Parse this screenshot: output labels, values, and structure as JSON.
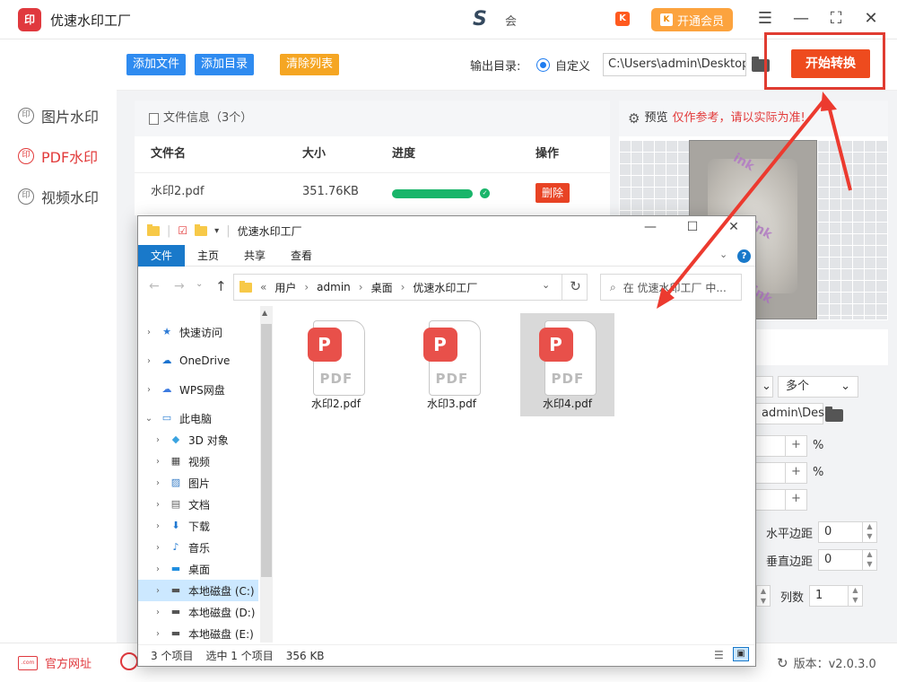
{
  "app": {
    "title": "优速水印工厂",
    "logo_text": "印",
    "username": "会"
  },
  "header": {
    "vip_label": "开通会员",
    "vip_icon_text": "K",
    "accent": "#ee4b1e"
  },
  "sidebar": {
    "items": [
      {
        "label": "图片水印",
        "icon": "印",
        "active": false
      },
      {
        "label": "PDF水印",
        "icon": "印",
        "active": true
      },
      {
        "label": "视频水印",
        "icon": "印",
        "active": false
      }
    ]
  },
  "toolbar": {
    "add_file": "添加文件",
    "add_dir": "添加目录",
    "clear_list": "清除列表",
    "output_label": "输出目录:",
    "custom_label": "自定义",
    "output_path": "C:\\Users\\admin\\Desktop",
    "start": "开始转换"
  },
  "filelist": {
    "header": "文件信息（3个）",
    "columns": [
      "文件名",
      "大小",
      "进度",
      "操作"
    ],
    "rows": [
      {
        "name": "水印2.pdf",
        "size": "351.76KB",
        "progress": 1.0,
        "action": "删除"
      }
    ]
  },
  "preview": {
    "label": "预览",
    "note": "仅作参考，请以实际为准!",
    "watermark": "ink"
  },
  "settings": {
    "select_value": "多个",
    "path_fragment": "admin\\Des",
    "pct1": "%",
    "pct2": "%",
    "h_margin_label": "水平边距",
    "h_margin_value": "0",
    "v_margin_label": "垂直边距",
    "v_margin_value": "0",
    "cols_label": "列数",
    "cols_value": "1"
  },
  "footer": {
    "website": "官方网址",
    "version": "版本：v2.0.3.0",
    "com_icon": ".com"
  },
  "explorer": {
    "title": "优速水印工厂",
    "ribbon_tabs": [
      "文件",
      "主页",
      "共享",
      "查看"
    ],
    "breadcrumb": [
      "用户",
      "admin",
      "桌面",
      "优速水印工厂"
    ],
    "search_placeholder": "在 优速水印工厂 中...",
    "nav": [
      {
        "label": "快速访问",
        "icon": "★",
        "color": "#2e7bd6"
      },
      {
        "label": "OneDrive",
        "icon": "☁",
        "color": "#1a73d0"
      },
      {
        "label": "WPS网盘",
        "icon": "☁",
        "color": "#3d7be0"
      },
      {
        "label": "此电脑",
        "icon": "▭",
        "color": "#2f7fd3"
      },
      {
        "label": "3D 对象",
        "icon": "◆",
        "color": "#3aa3e0"
      },
      {
        "label": "视频",
        "icon": "▦",
        "color": "#444"
      },
      {
        "label": "图片",
        "icon": "▨",
        "color": "#3a7fc8"
      },
      {
        "label": "文档",
        "icon": "▤",
        "color": "#666"
      },
      {
        "label": "下载",
        "icon": "⬇",
        "color": "#1f78d1"
      },
      {
        "label": "音乐",
        "icon": "♪",
        "color": "#1f78d1"
      },
      {
        "label": "桌面",
        "icon": "▬",
        "color": "#1f8ee0"
      },
      {
        "label": "本地磁盘 (C:)",
        "icon": "▬",
        "color": "#555"
      },
      {
        "label": "本地磁盘 (D:)",
        "icon": "▬",
        "color": "#555"
      },
      {
        "label": "本地磁盘 (E:)",
        "icon": "▬",
        "color": "#555"
      }
    ],
    "files": [
      "水印2.pdf",
      "水印3.pdf",
      "水印4.pdf"
    ],
    "file_badge_text": "P",
    "file_type_text": "PDF",
    "status_count": "3 个项目",
    "status_selected": "选中 1 个项目",
    "status_size": "356 KB"
  }
}
